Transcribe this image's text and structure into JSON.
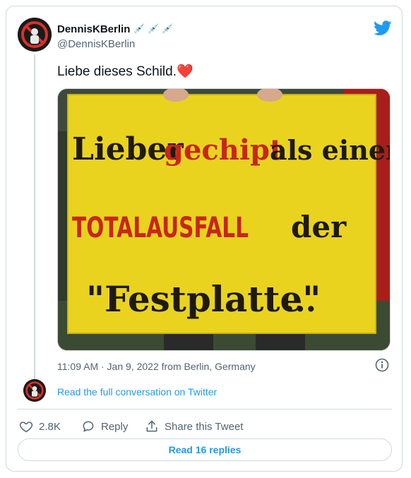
{
  "author": {
    "name": "DennisKBerlin",
    "name_decoration": "💉💉💉",
    "handle": "@DennisKBerlin"
  },
  "tweet": {
    "text": "Liebe dieses Schild.",
    "emoji": "❤️"
  },
  "media": {
    "sign": {
      "line1_a": "Lieber",
      "line1_b": "gechipt",
      "line1_c": "als einen",
      "line2_a": "TOTALAUSFALL",
      "line2_b": "der",
      "line3_a": "\"Festplatte\"",
      "line3_b": "..."
    }
  },
  "meta": {
    "timestamp": "11:09 AM · Jan 9, 2022 from Berlin, Germany"
  },
  "conversation": {
    "link_label": "Read the full conversation on Twitter"
  },
  "actions": {
    "likes": "2.8K",
    "reply_label": "Reply",
    "share_label": "Share this Tweet"
  },
  "footer": {
    "read_replies_label": "Read 16 replies"
  },
  "colors": {
    "twitter_blue": "#1d9bf0",
    "sign_yellow": "#e9d31f",
    "sign_red": "#c7261b",
    "heart": "#e0245e"
  }
}
